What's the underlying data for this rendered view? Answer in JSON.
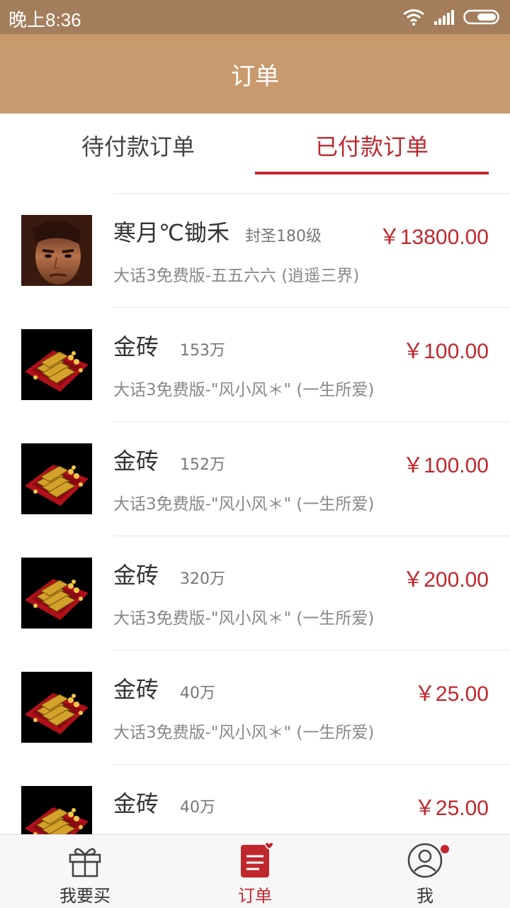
{
  "status_bar": {
    "time": "晚上8:36",
    "wifi_icon": "wifi-icon",
    "signal_icon": "signal-icon",
    "battery_icon": "battery-icon"
  },
  "header": {
    "title": "订单"
  },
  "tabs": [
    {
      "label": "待付款订单",
      "active": false
    },
    {
      "label": "已付款订单",
      "active": true
    }
  ],
  "orders": [
    {
      "thumb": "character-portrait",
      "name": "寒月℃锄禾",
      "detail": "封圣180级",
      "price": "￥13800.00",
      "server": "大话3免费版-五五六六 (逍遥三界)"
    },
    {
      "thumb": "gold-bricks",
      "name": "金砖",
      "detail": "153万",
      "price": "￥100.00",
      "server": "大话3免费版-\"风小风＊\" (一生所爱)"
    },
    {
      "thumb": "gold-bricks",
      "name": "金砖",
      "detail": "152万",
      "price": "￥100.00",
      "server": "大话3免费版-\"风小风＊\" (一生所爱)"
    },
    {
      "thumb": "gold-bricks",
      "name": "金砖",
      "detail": "320万",
      "price": "￥200.00",
      "server": "大话3免费版-\"风小风＊\" (一生所爱)"
    },
    {
      "thumb": "gold-bricks",
      "name": "金砖",
      "detail": "40万",
      "price": "￥25.00",
      "server": "大话3免费版-\"风小风＊\" (一生所爱)"
    },
    {
      "thumb": "gold-bricks",
      "name": "金砖",
      "detail": "40万",
      "price": "￥25.00",
      "server": ""
    }
  ],
  "bottom_nav": [
    {
      "label": "我要买",
      "icon": "gift-icon",
      "active": false
    },
    {
      "label": "订单",
      "icon": "order-list-icon",
      "active": true
    },
    {
      "label": "我",
      "icon": "user-icon",
      "active": false
    }
  ],
  "colors": {
    "status_bar": "#a47e5c",
    "title_bar": "#c99a6e",
    "accent_red": "#c0272d"
  }
}
